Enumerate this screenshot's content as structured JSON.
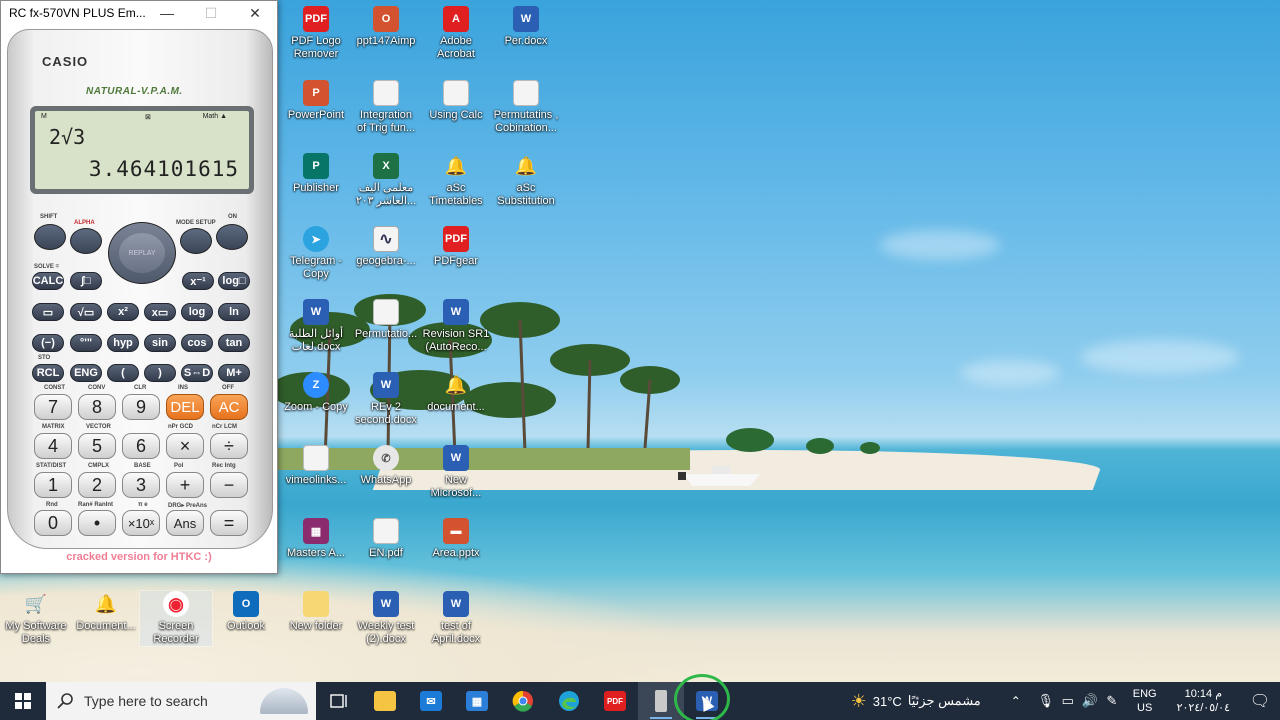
{
  "window": {
    "title": "RC fx-570VN PLUS Em...",
    "minimize": "—",
    "maximize": "☐",
    "close": "✕"
  },
  "calculator": {
    "brand": "CASIO",
    "model_tag": "NATURAL-V.P.A.M.",
    "display": {
      "indicator_m": "M",
      "indicator_mid": "⊠",
      "indicator_math": "Math ▲",
      "expression": "2√3",
      "result": "3.464101615"
    },
    "replay": "REPLAY",
    "labels": {
      "shift": "SHIFT",
      "alpha": "ALPHA",
      "mode": "MODE SETUP",
      "on": "ON"
    },
    "function_keys": {
      "calc": "CALC",
      "integral": "∫□",
      "inverse": "x⁻¹",
      "logb": "log□",
      "frac": "▭",
      "sqrt": "√▭",
      "x2": "x²",
      "xpow": "x▭",
      "log": "log",
      "ln": "ln",
      "neg": "(−)",
      "deg": "°'\"",
      "hyp": "hyp",
      "sin": "sin",
      "cos": "cos",
      "tan": "tan",
      "rcl": "RCL",
      "eng": "ENG",
      "lparen": "(",
      "rparen": ")",
      "sd": "S⇔D",
      "mplus": "M+"
    },
    "number_keys": {
      "k7": "7",
      "k8": "8",
      "k9": "9",
      "del": "DEL",
      "ac": "AC",
      "k4": "4",
      "k5": "5",
      "k6": "6",
      "mul": "×",
      "div": "÷",
      "k1": "1",
      "k2": "2",
      "k3": "3",
      "add": "+",
      "sub": "−",
      "k0": "0",
      "dot": "•",
      "exp": "×10ˣ",
      "ans": "Ans",
      "eq": "="
    },
    "shift_labels": {
      "solve": "SOLVE =",
      "sto": "STO",
      "const": "CONST",
      "conv": "CONV",
      "clr": "CLR",
      "ins": "INS",
      "off": "OFF",
      "matrix": "MATRIX",
      "vector": "VECTOR",
      "npr": "nPr GCD",
      "ncr": "nCr LCM",
      "statdist": "STAT/DIST",
      "cmplx": "CMPLX",
      "base": "BASE",
      "pol": "Pol",
      "rec": "Rec Intg",
      "rnd": "Rnd",
      "ranint": "Ran# RanInt",
      "pi": "π e",
      "drg": "DRG▸ PreAns"
    },
    "footer": "cracked version for HTKC :)"
  },
  "desktop_icons": [
    {
      "label": "PDF Logo\nRemover",
      "icon": "pdf-icon",
      "glyph": "PDF"
    },
    {
      "label": "ppt147Aimp",
      "icon": "office-icon",
      "glyph": "O"
    },
    {
      "label": "Adobe\nAcrobat",
      "icon": "acrobat-icon",
      "glyph": "A"
    },
    {
      "label": "Per.docx",
      "icon": "word-icon",
      "glyph": "W"
    },
    {
      "label": "PowerPoint",
      "icon": "powerpoint-icon",
      "glyph": "P"
    },
    {
      "label": "Integration\nof Trig fun...",
      "icon": "document-icon",
      "glyph": ""
    },
    {
      "label": "Using Calc",
      "icon": "document-icon",
      "glyph": ""
    },
    {
      "label": "Permutatins ,\nCobination...",
      "icon": "document-icon",
      "glyph": ""
    },
    {
      "label": "Publisher",
      "icon": "publisher-icon",
      "glyph": "P"
    },
    {
      "label": "معلمی الیف\nالعاشر ٢٠٣...",
      "icon": "excel-icon",
      "glyph": "X"
    },
    {
      "label": "aSc\nTimetables",
      "icon": "bell-icon",
      "glyph": "🔔"
    },
    {
      "label": "aSc\nSubstitution",
      "icon": "bell-icon",
      "glyph": "🔔"
    },
    {
      "label": "Telegram -\nCopy",
      "icon": "telegram-icon",
      "glyph": "➤"
    },
    {
      "label": "geogebra-...",
      "icon": "geogebra-icon",
      "glyph": "∿"
    },
    {
      "label": "PDFgear",
      "icon": "pdf-icon",
      "glyph": "PDF"
    },
    {
      "label": "أوائل الطلبة\nلغات.docx",
      "icon": "word-icon",
      "glyph": "W"
    },
    {
      "label": "Permutatio...",
      "icon": "document-icon",
      "glyph": ""
    },
    {
      "label": "Revision SR1\n(AutoReco...",
      "icon": "word-icon",
      "glyph": "W"
    },
    {
      "label": "Zoom - Copy",
      "icon": "zoom-icon",
      "glyph": "Z"
    },
    {
      "label": "REv 2\nsecond.docx",
      "icon": "word-icon",
      "glyph": "W"
    },
    {
      "label": "document...",
      "icon": "bell-icon",
      "glyph": "🔔"
    },
    {
      "label": "vimeolinks...",
      "icon": "document-icon",
      "glyph": ""
    },
    {
      "label": "WhatsApp",
      "icon": "whatsapp-icon",
      "glyph": "✆"
    },
    {
      "label": "New\nMicrosof...",
      "icon": "word-icon",
      "glyph": "W"
    },
    {
      "label": "Masters A...",
      "icon": "winrar-icon",
      "glyph": "▦"
    },
    {
      "label": "EN.pdf",
      "icon": "document-icon",
      "glyph": ""
    },
    {
      "label": "Area.pptx",
      "icon": "powerpoint-icon",
      "glyph": "▬"
    },
    {
      "label": "My Software\nDeals",
      "icon": "cart-icon",
      "glyph": "🛒"
    },
    {
      "label": "Document...",
      "icon": "bell-icon",
      "glyph": "🔔"
    },
    {
      "label": "Screen\nRecorder",
      "icon": "record-icon",
      "glyph": "◉"
    },
    {
      "label": "Outlook",
      "icon": "outlook-icon",
      "glyph": "O"
    },
    {
      "label": "New folder",
      "icon": "folder-icon",
      "glyph": ""
    },
    {
      "label": "Weekly test\n(2).docx",
      "icon": "word-icon",
      "glyph": "W"
    },
    {
      "label": "test of\nApril.docx",
      "icon": "word-icon",
      "glyph": "W"
    }
  ],
  "taskbar": {
    "search_placeholder": "Type here to search",
    "weather_temp": "31°C",
    "weather_text": "مشمس جزئيًا",
    "lang_top": "ENG",
    "lang_bottom": "US",
    "time": "10:14 م",
    "date": "٢٠٢٤/٠٥/٠٤"
  }
}
